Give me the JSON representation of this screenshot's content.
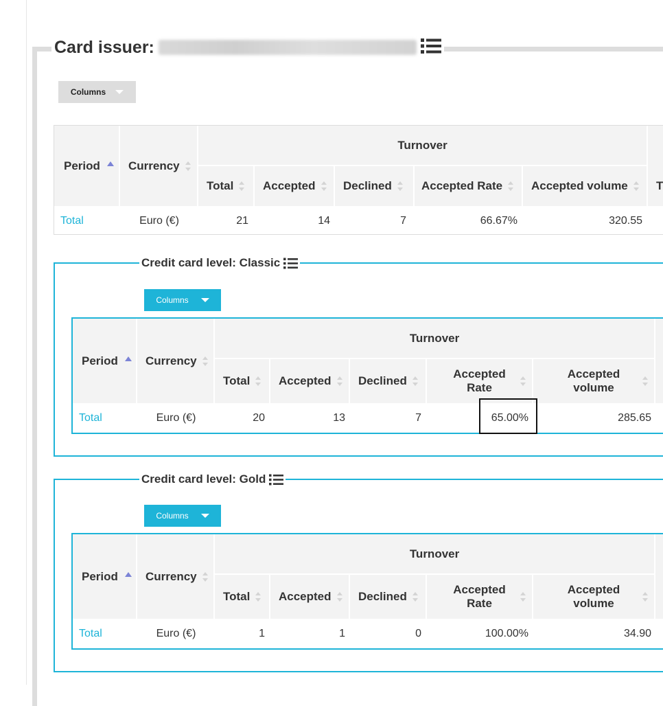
{
  "card_issuer": {
    "label": "Card issuer:"
  },
  "columns_label": "Columns",
  "main_table": {
    "headers": {
      "period": "Period",
      "currency": "Currency",
      "group": "Turnover",
      "total": "Total",
      "accepted": "Accepted",
      "declined": "Declined",
      "accepted_rate": "Accepted Rate",
      "accepted_volume": "Accepted volume",
      "next": "T"
    },
    "row": {
      "period": "Total",
      "currency": "Euro (€)",
      "total": "21",
      "accepted": "14",
      "declined": "7",
      "accepted_rate": "66.67%",
      "accepted_volume": "320.55"
    }
  },
  "classic": {
    "legend": "Credit card level: Classic",
    "headers": {
      "period": "Period",
      "currency": "Currency",
      "group": "Turnover",
      "total": "Total",
      "accepted": "Accepted",
      "declined": "Declined",
      "accepted_rate_1": "Accepted",
      "accepted_rate_2": "Rate",
      "accepted_volume_1": "Accepted",
      "accepted_volume_2": "volume"
    },
    "row": {
      "period": "Total",
      "currency": "Euro (€)",
      "total": "20",
      "accepted": "13",
      "declined": "7",
      "accepted_rate": "65.00%",
      "accepted_volume": "285.65"
    }
  },
  "gold": {
    "legend": "Credit card level: Gold",
    "headers": {
      "period": "Period",
      "currency": "Currency",
      "group": "Turnover",
      "total": "Total",
      "accepted": "Accepted",
      "declined": "Declined",
      "accepted_rate_1": "Accepted",
      "accepted_rate_2": "Rate",
      "accepted_volume_1": "Accepted",
      "accepted_volume_2": "volume"
    },
    "row": {
      "period": "Total",
      "currency": "Euro (€)",
      "total": "1",
      "accepted": "1",
      "declined": "0",
      "accepted_rate": "100.00%",
      "accepted_volume": "34.90"
    }
  },
  "colors": {
    "accent": "#1eb4d8",
    "sort_active": "#7b83d6",
    "header_bg": "#f3f3f3"
  }
}
